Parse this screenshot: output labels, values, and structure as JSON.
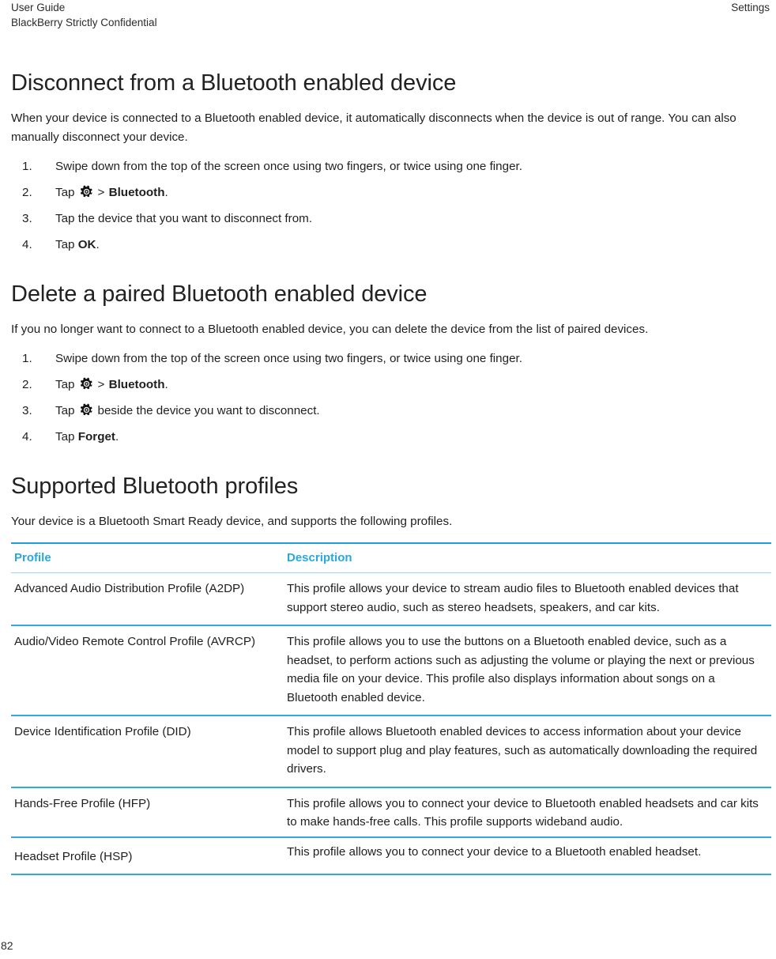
{
  "header": {
    "left_line1": "User Guide",
    "left_line2": "BlackBerry Strictly Confidential",
    "right": "Settings"
  },
  "sections": [
    {
      "title": "Disconnect from a Bluetooth enabled device",
      "intro": "When your device is connected to a Bluetooth enabled device, it automatically disconnects when the device is out of range. You can also manually disconnect your device.",
      "steps": [
        {
          "pre": "Swipe down from the top of the screen once using two fingers, or twice using one finger.",
          "icon": null,
          "mid": "",
          "bold": "",
          "post": ""
        },
        {
          "pre": "Tap",
          "icon": "gear-icon",
          "mid": ">",
          "bold": "Bluetooth",
          "post": "."
        },
        {
          "pre": "Tap the device that you want to disconnect from.",
          "icon": null,
          "mid": "",
          "bold": "",
          "post": ""
        },
        {
          "pre": "Tap",
          "icon": null,
          "mid": "",
          "bold": "OK",
          "post": "."
        }
      ]
    },
    {
      "title": "Delete a paired Bluetooth enabled device",
      "intro": "If you no longer want to connect to a Bluetooth enabled device, you can delete the device from the list of paired devices.",
      "steps": [
        {
          "pre": "Swipe down from the top of the screen once using two fingers, or twice using one finger.",
          "icon": null,
          "mid": "",
          "bold": "",
          "post": ""
        },
        {
          "pre": "Tap",
          "icon": "gear-icon",
          "mid": ">",
          "bold": "Bluetooth",
          "post": "."
        },
        {
          "pre": "Tap",
          "icon": "gear-icon",
          "mid": "beside the device you want to disconnect.",
          "bold": "",
          "post": ""
        },
        {
          "pre": "Tap",
          "icon": null,
          "mid": "",
          "bold": "Forget",
          "post": "."
        }
      ]
    },
    {
      "title": "Supported Bluetooth profiles",
      "intro": "Your device is a Bluetooth Smart Ready device, and supports the following profiles.",
      "steps": []
    }
  ],
  "table": {
    "columns": [
      "Profile",
      "Description"
    ],
    "rows": [
      {
        "profile": "Advanced Audio Distribution Profile (A2DP)",
        "description": "This profile allows your device to stream audio files to Bluetooth enabled devices that support stereo audio, such as stereo headsets, speakers, and car kits."
      },
      {
        "profile": "Audio/Video Remote Control Profile (AVRCP)",
        "description": "This profile allows you to use the buttons on a Bluetooth enabled device, such as a headset, to perform actions such as adjusting the volume or playing the next or previous media file on your device. This profile also displays information about songs on a Bluetooth enabled device."
      },
      {
        "profile": "Device Identification Profile (DID)",
        "description": "This profile allows Bluetooth enabled devices to access information about your device model to support plug and play features, such as automatically downloading the required drivers."
      },
      {
        "profile": "Hands-Free Profile (HFP)",
        "description": "This profile allows you to connect your device to Bluetooth enabled headsets and car kits to make hands-free calls. This profile supports wideband audio."
      },
      {
        "profile": "Headset Profile (HSP)",
        "description": "This profile allows you to connect your device to a Bluetooth enabled headset."
      }
    ]
  },
  "footer": {
    "page_number": "82"
  },
  "colors": {
    "accent_blue": "#28a7e0",
    "rule_blue": "#34a9dd",
    "text": "#1f1f1f"
  }
}
